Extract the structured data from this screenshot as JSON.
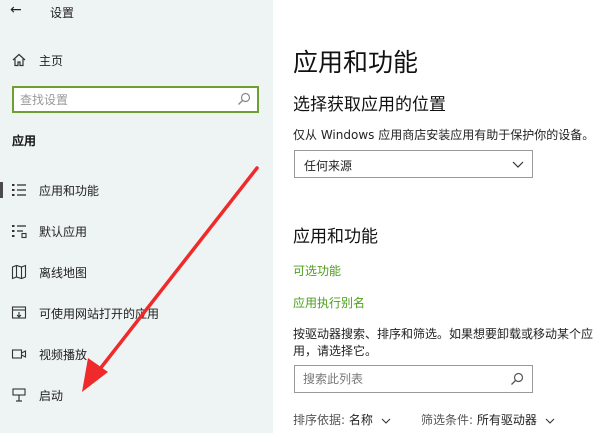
{
  "window": {
    "back_glyph": "←",
    "title": "设置"
  },
  "sidebar": {
    "home_label": "主页",
    "search_placeholder": "查找设置",
    "section_label": "应用",
    "items": [
      {
        "label": "应用和功能",
        "icon": "apps-features-icon",
        "selected": true
      },
      {
        "label": "默认应用",
        "icon": "default-apps-icon",
        "selected": false
      },
      {
        "label": "离线地图",
        "icon": "offline-maps-icon",
        "selected": false
      },
      {
        "label": "可使用网站打开的应用",
        "icon": "apps-for-websites-icon",
        "selected": false
      },
      {
        "label": "视频播放",
        "icon": "video-playback-icon",
        "selected": false
      },
      {
        "label": "启动",
        "icon": "startup-icon",
        "selected": false
      }
    ]
  },
  "main": {
    "page_title": "应用和功能",
    "install_section_title": "选择获取应用的位置",
    "install_desc": "仅从 Windows 应用商店安装应用有助于保护你的设备。",
    "install_source_value": "任何来源",
    "apps_section_title": "应用和功能",
    "optional_features_link": "可选功能",
    "app_alias_link": "应用执行别名",
    "search_desc": "按驱动器搜索、排序和筛选。如果想要卸载或移动某个应用，请选择它。",
    "search_placeholder": "搜索此列表",
    "sort_label": "排序依据:",
    "sort_value": "名称",
    "filter_label": "筛选条件:",
    "filter_value": "所有驱动器"
  },
  "colors": {
    "accent_green": "#4b9f1c",
    "search_border": "#6f9f33",
    "annotation_red": "#ee2a2a",
    "sidebar_bg": "#eef3f3"
  }
}
